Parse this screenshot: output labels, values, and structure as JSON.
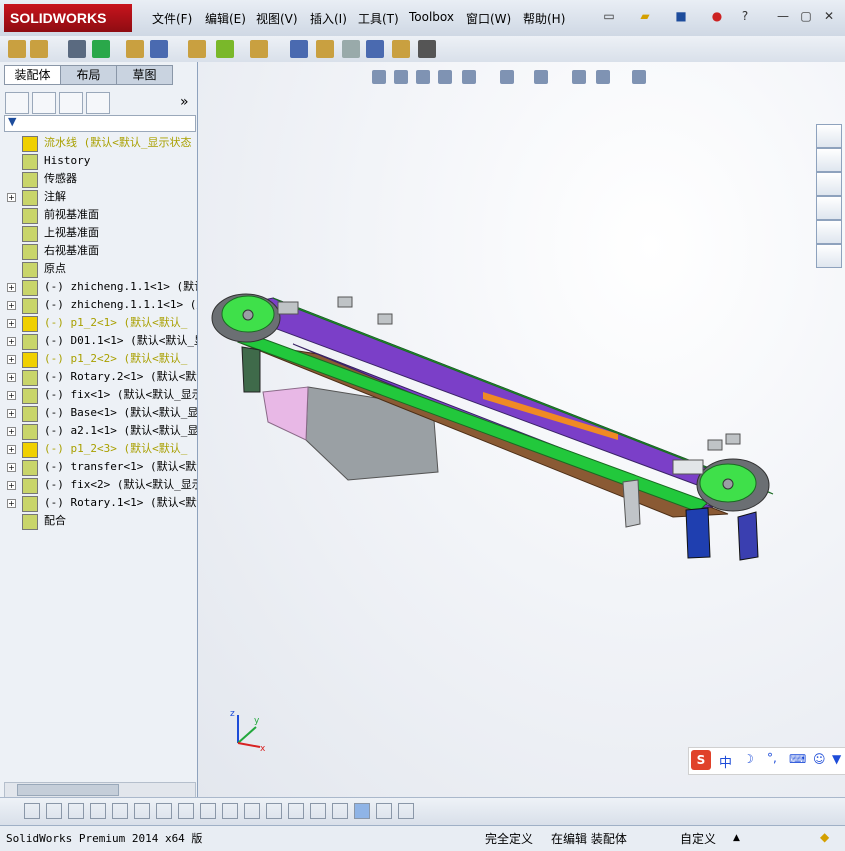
{
  "app": {
    "logo_text": "SOLIDWORKS"
  },
  "menu": {
    "items": [
      "文件(F)",
      "编辑(E)",
      "视图(V)",
      "插入(I)",
      "工具(T)",
      "Toolbox",
      "窗口(W)",
      "帮助(H)"
    ]
  },
  "panel": {
    "tabs": [
      "装配体",
      "布局",
      "草图"
    ],
    "collapse_label": "»",
    "tree": [
      {
        "label": "流水线  (默认<默认_显示状态",
        "warn": true,
        "exp": false
      },
      {
        "label": "History",
        "exp": false
      },
      {
        "label": "传感器",
        "exp": false
      },
      {
        "label": "注解",
        "exp": true
      },
      {
        "label": "前视基准面",
        "exp": false
      },
      {
        "label": "上视基准面",
        "exp": false
      },
      {
        "label": "右视基准面",
        "exp": false
      },
      {
        "label": "原点",
        "exp": false
      },
      {
        "label": "(-) zhicheng.1.1<1> (默认<",
        "exp": true
      },
      {
        "label": "(-) zhicheng.1.1.1<1> (默认",
        "exp": true
      },
      {
        "label": "(-) p1_2<1> (默认<默认_",
        "warn": true,
        "exp": true
      },
      {
        "label": "(-) D01.1<1> (默认<默认_显",
        "exp": true
      },
      {
        "label": "(-) p1_2<2> (默认<默认_",
        "warn": true,
        "exp": true
      },
      {
        "label": "(-) Rotary.2<1> (默认<默认_",
        "exp": true
      },
      {
        "label": "(-) fix<1> (默认<默认_显示",
        "exp": true
      },
      {
        "label": "(-) Base<1> (默认<默认_显",
        "exp": true
      },
      {
        "label": "(-) a2.1<1> (默认<默认_显",
        "exp": true
      },
      {
        "label": "(-) p1_2<3> (默认<默认_",
        "warn": true,
        "exp": true
      },
      {
        "label": "(-) transfer<1> (默认<默认_",
        "exp": true
      },
      {
        "label": "(-) fix<2> (默认<默认_显示",
        "exp": true
      },
      {
        "label": "(-) Rotary.1<1> (默认<默认_",
        "exp": true
      },
      {
        "label": "配合",
        "exp": false
      }
    ]
  },
  "triad": {
    "x": "x",
    "y": "y",
    "z": "z"
  },
  "ime": {
    "label": "中"
  },
  "status": {
    "version": "SolidWorks Premium 2014 x64 版",
    "definition": "完全定义",
    "mode": "在编辑 装配体",
    "units": "自定义"
  },
  "colors": {
    "accent": "#c8141d",
    "conveyor_purple": "#7b3fc8",
    "conveyor_green": "#22c83c",
    "conveyor_brown": "#8a5a34"
  }
}
